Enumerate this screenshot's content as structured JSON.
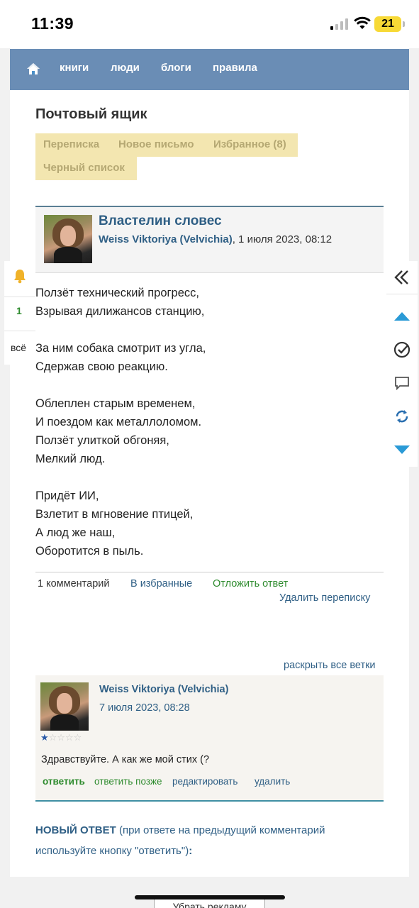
{
  "status": {
    "time": "11:39",
    "battery": "21"
  },
  "nav": {
    "items": [
      "книги",
      "люди",
      "блоги",
      "правила"
    ]
  },
  "page": {
    "title": "Почтовый ящик"
  },
  "tabs": [
    "Переписка",
    "Новое письмо",
    "Избранное (8)",
    "Черный список"
  ],
  "letter": {
    "subject": "Властелин словес",
    "author": "Weiss Viktoriya (Velvichia)",
    "date": ", 1 июля 2023, 08:12",
    "poem": [
      "Ползёт технический прогресс,",
      "Взрывая дилижансов станцию,",
      "",
      "За ним собака смотрит из угла,",
      "Сдержав свою реакцию.",
      "",
      "Облеплен старым временем,",
      "И поездом как металлоломом.",
      "Ползёт улиткой обгоняя,",
      "Мелкий люд.",
      "",
      "Придёт ИИ,",
      "Взлетит в мгновение птицей,",
      "А люд же наш,",
      "Оборотится в пыль."
    ],
    "actions": {
      "comments": "1 комментарий",
      "favorite": "В избранные",
      "postpone": "Отложить ответ",
      "delete_thread": "Удалить переписку"
    }
  },
  "expand_all": "раскрыть все ветки",
  "comment": {
    "author": "Weiss Viktoriya (Velvichia)",
    "date": "7 июля 2023, 08:28",
    "rating": 1,
    "text": "Здравствуйте. А как же мой стих (?",
    "actions": {
      "reply": "ответить",
      "reply_later": "ответить позже",
      "edit": "редактировать",
      "delete": "удалить"
    }
  },
  "new_reply": {
    "label": "НОВЫЙ ОТВЕТ",
    "hint_line1": " (при ответе на предыдущий комментарий",
    "hint_line2": "используйте кнопку \"ответить\")",
    "colon": ":"
  },
  "left_widget": {
    "count": "1",
    "all": "всё"
  },
  "ad_button": "Убрать рекламу",
  "colors": {
    "nav_bg": "#6a8db5",
    "tab_bg": "#f3e6b0",
    "link": "#2f5f85",
    "green": "#2e8b2e"
  }
}
